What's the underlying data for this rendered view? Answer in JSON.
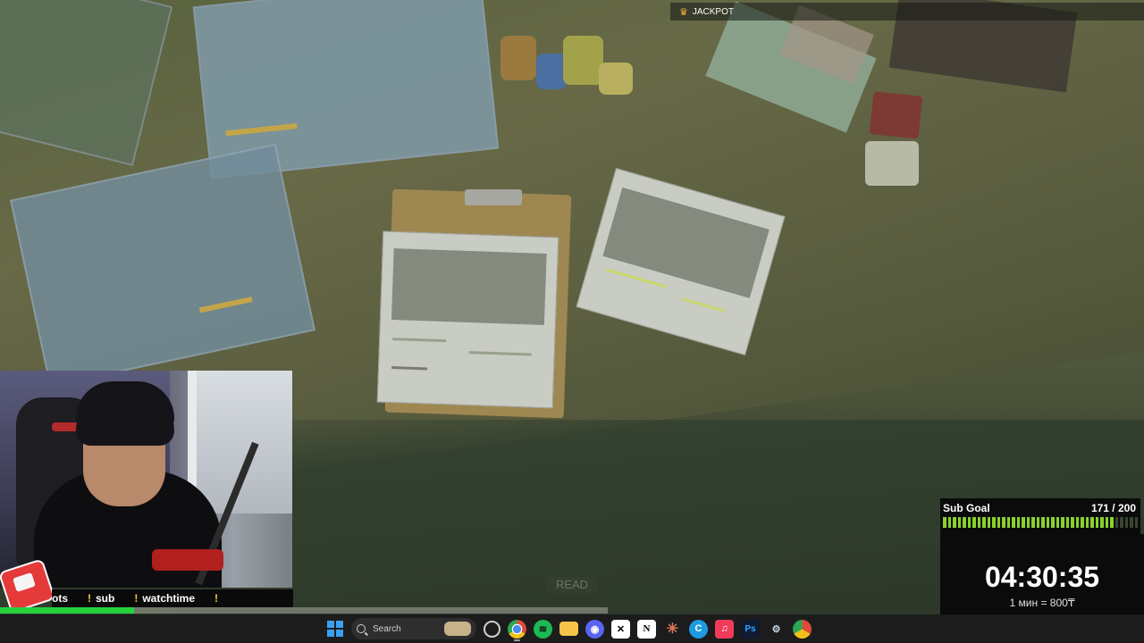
{
  "jackpot": {
    "label": "JACKPOT"
  },
  "game": {
    "read_prompt": "READ"
  },
  "ticker": {
    "commands": [
      {
        "label": "ots"
      },
      {
        "label": "sub"
      },
      {
        "label": "watchtime"
      }
    ],
    "progress": 0.22
  },
  "sub_goal": {
    "label": "Sub Goal",
    "count": "171 / 200",
    "current": 171,
    "target": 200,
    "segments_filled": 35,
    "segments_total": 40,
    "color": "#8ad12f"
  },
  "timer": {
    "time": "04:30:35",
    "rate": "1 мин = 800₸"
  },
  "taskbar": {
    "search_label": "Search",
    "apps": [
      {
        "name": "windows-start-icon"
      },
      {
        "name": "search-box"
      },
      {
        "name": "task-view-icon"
      },
      {
        "name": "chrome-icon"
      },
      {
        "name": "spotify-icon"
      },
      {
        "name": "file-explorer-icon"
      },
      {
        "name": "discord-icon"
      },
      {
        "name": "capcut-icon"
      },
      {
        "name": "notion-icon"
      },
      {
        "name": "claude-icon"
      },
      {
        "name": "browser-icon"
      },
      {
        "name": "music-icon"
      },
      {
        "name": "photoshop-icon"
      },
      {
        "name": "steam-icon"
      },
      {
        "name": "chrome-profile-icon"
      }
    ]
  }
}
